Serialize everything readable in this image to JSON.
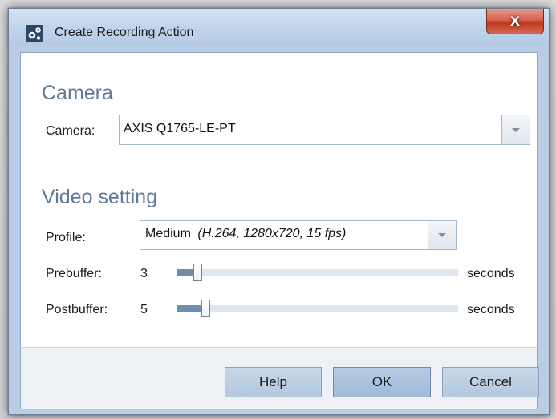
{
  "window": {
    "title": "Create Recording Action",
    "close_glyph": "X"
  },
  "camera_section": {
    "title": "Camera",
    "camera_label": "Camera:",
    "camera_value": "AXIS Q1765-LE-PT"
  },
  "video_section": {
    "title": "Video setting",
    "profile_label": "Profile:",
    "profile_name": "Medium",
    "profile_detail": "(H.264, 1280x720, 15 fps)",
    "prebuffer_label": "Prebuffer:",
    "prebuffer_value": "3",
    "prebuffer_fraction": 0.07,
    "prebuffer_unit": "seconds",
    "postbuffer_label": "Postbuffer:",
    "postbuffer_value": "5",
    "postbuffer_fraction": 0.1,
    "postbuffer_unit": "seconds"
  },
  "buttons": {
    "help": "Help",
    "ok": "OK",
    "cancel": "Cancel"
  },
  "colors": {
    "accent": "#5f7a96",
    "close": "#c8452f"
  },
  "icons": {
    "app": "gear-cluster-icon",
    "close": "close-icon",
    "dropdown": "chevron-down-icon"
  }
}
